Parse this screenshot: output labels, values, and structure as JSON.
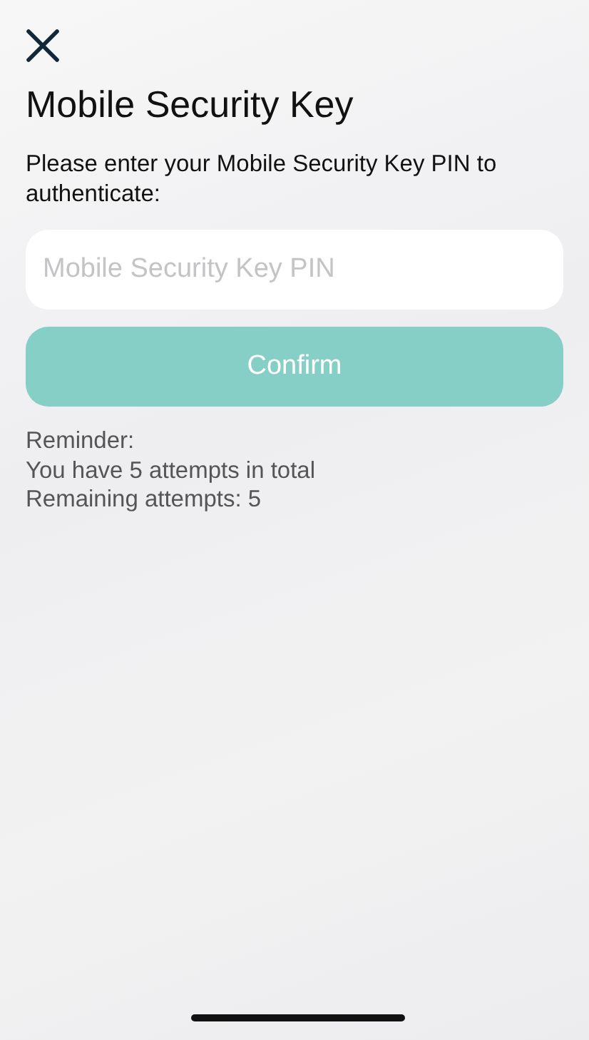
{
  "title": "Mobile Security Key",
  "instruction": "Please enter your Mobile Security Key PIN to authenticate:",
  "pin_field": {
    "placeholder": "Mobile Security Key PIN"
  },
  "confirm_button": {
    "label": "Confirm",
    "disabled": true
  },
  "reminder": [
    "Reminder:",
    "You have 5 attempts in total",
    "Remaining attempts: 5"
  ]
}
